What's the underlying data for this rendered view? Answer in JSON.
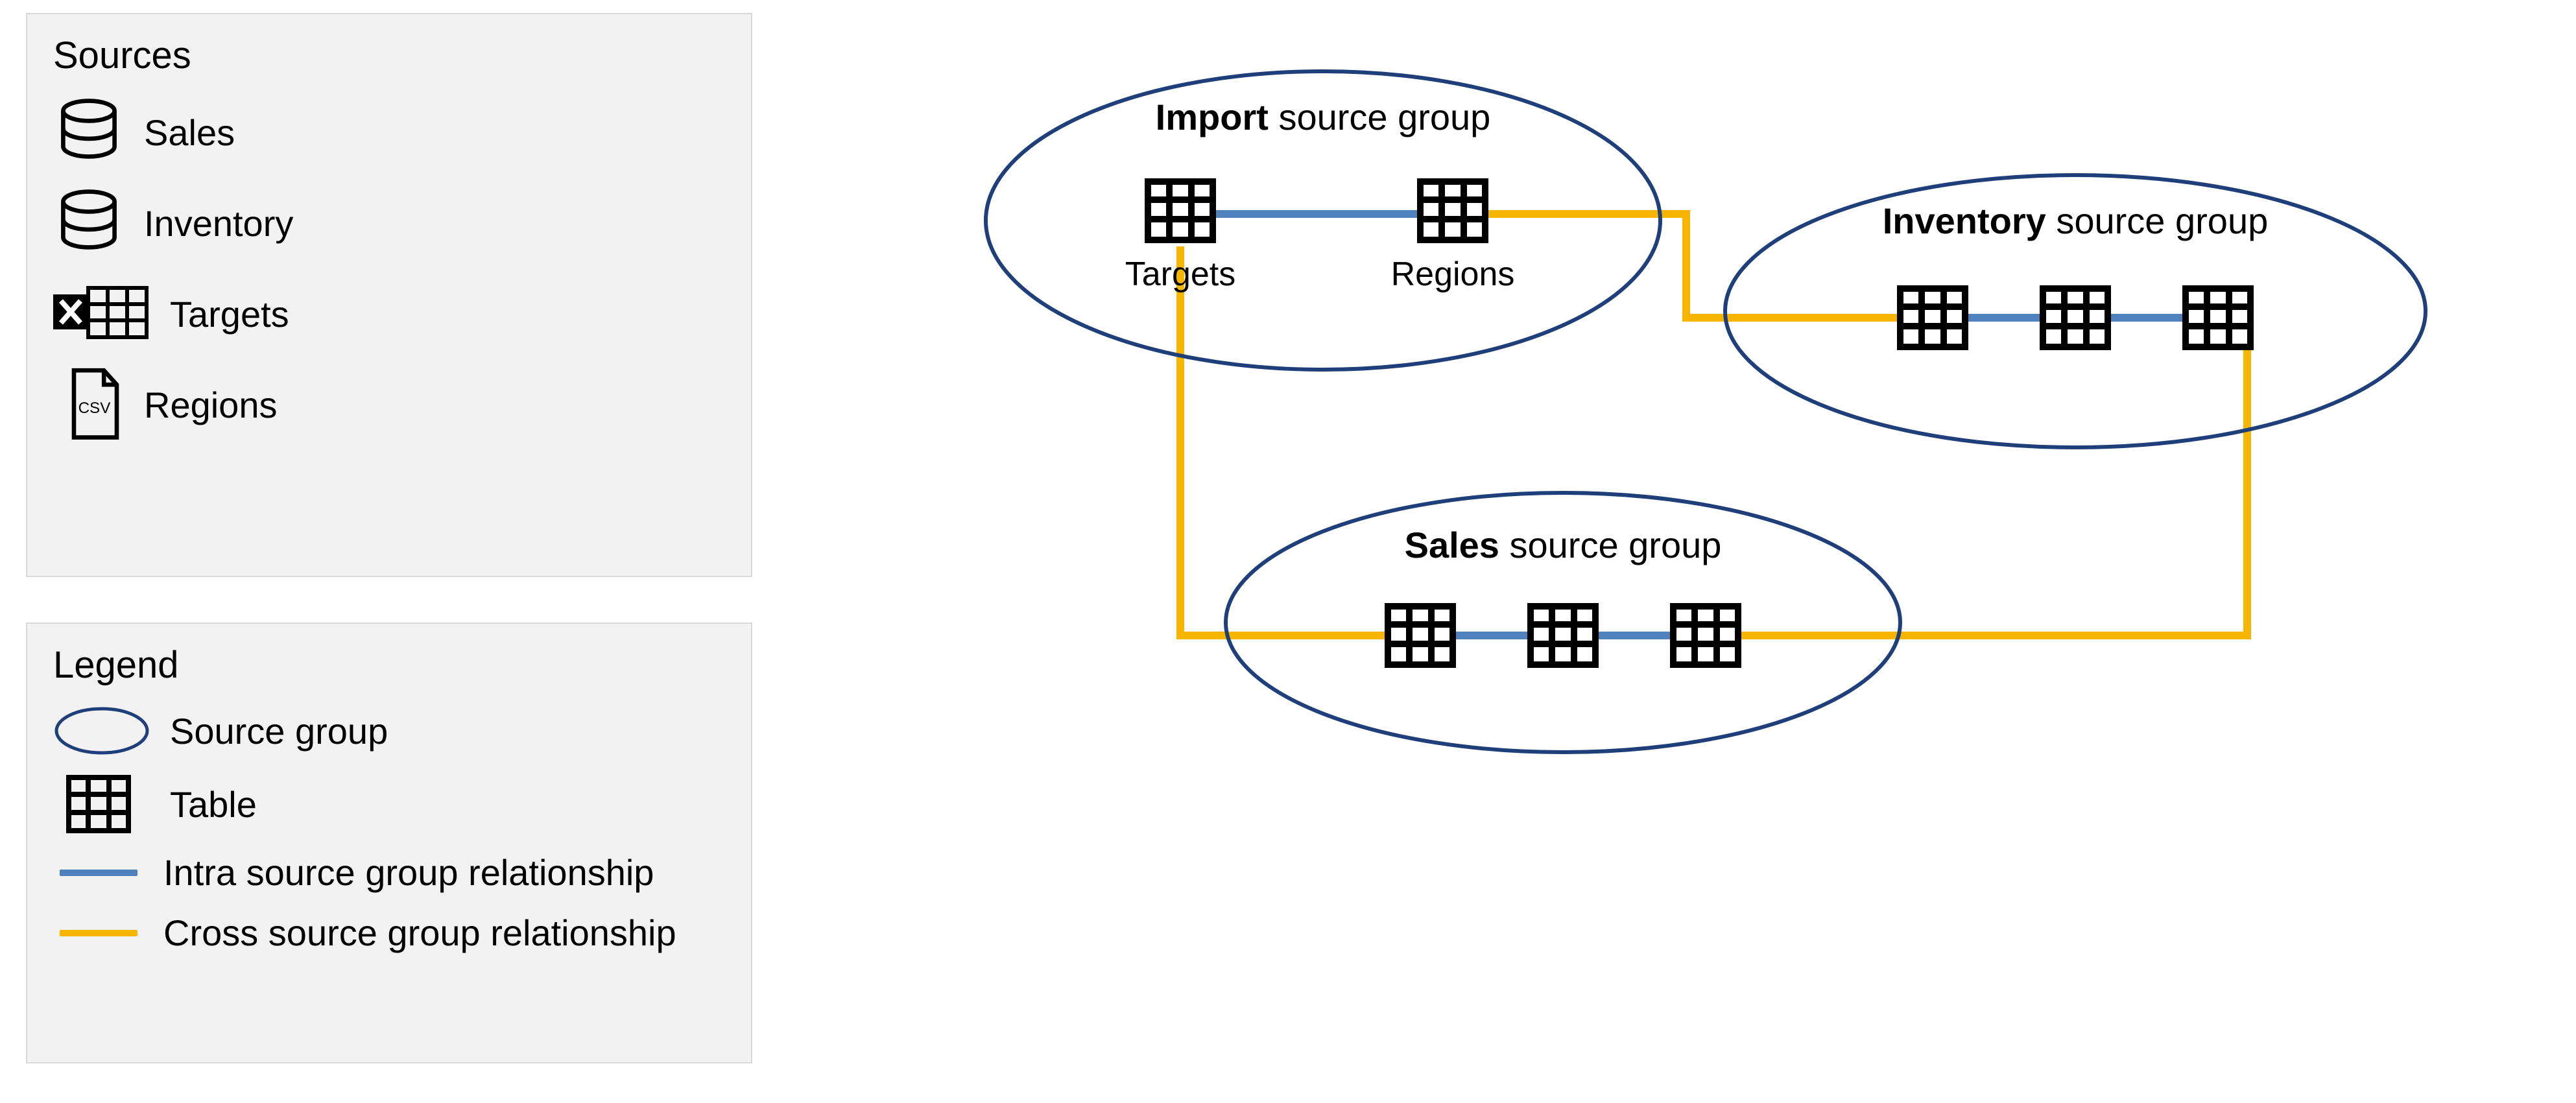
{
  "sources_panel": {
    "title": "Sources",
    "items": [
      {
        "label": "Sales",
        "icon": "database-icon"
      },
      {
        "label": "Inventory",
        "icon": "database-icon"
      },
      {
        "label": "Targets",
        "icon": "excel-icon"
      },
      {
        "label": "Regions",
        "icon": "csv-file-icon"
      }
    ]
  },
  "legend_panel": {
    "title": "Legend",
    "source_group_label": "Source group",
    "table_label": "Table",
    "intra_label": "Intra source group relationship",
    "cross_label": "Cross source group relationship"
  },
  "diagram": {
    "groups": {
      "import": {
        "bold": "Import",
        "rest": " source group",
        "tables": [
          "Targets",
          "Regions"
        ]
      },
      "inventory": {
        "bold": "Inventory",
        "rest": " source group"
      },
      "sales": {
        "bold": "Sales",
        "rest": " source group"
      }
    },
    "colors": {
      "ellipse_stroke": "#1f3f7a",
      "intra": "#4f81bd",
      "cross": "#f7b500",
      "icon_stroke": "#000000"
    }
  }
}
